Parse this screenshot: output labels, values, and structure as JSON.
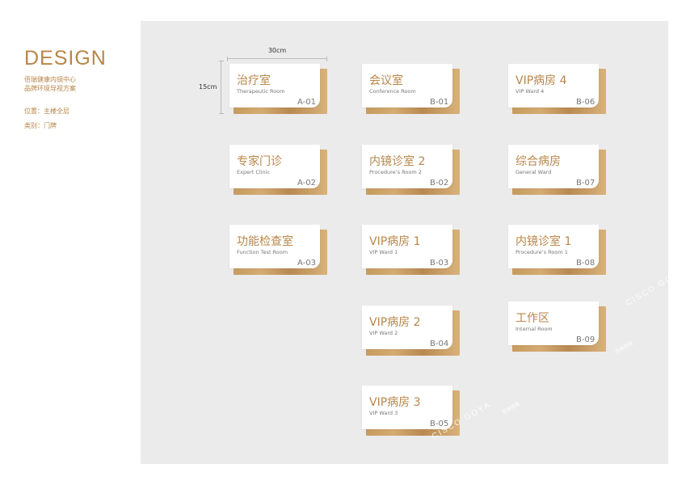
{
  "header": {
    "title": "DESIGN",
    "subtitle_line1": "佰瑞健康内镜中心",
    "subtitle_line2": "品牌环境导视方案",
    "location": "位置：主楼全层",
    "category": "类别：门牌"
  },
  "dimensions": {
    "width_label": "30cm",
    "height_label": "15cm"
  },
  "signs": [
    {
      "cn": "治疗室",
      "en": "Therapeutic  Room",
      "code": "A-01"
    },
    {
      "cn": "专家门诊",
      "en": "Expert Clinic",
      "code": "A-02"
    },
    {
      "cn": "功能检查室",
      "en": "Function  Test  Room",
      "code": "A-03"
    },
    {
      "cn": "会议室",
      "en": "Conference Room",
      "code": "B-01"
    },
    {
      "cn": "内镜诊室 2",
      "en": "Procedure’s  Room 2",
      "code": "B-02"
    },
    {
      "cn": "VIP病房 1",
      "en": "VIP   Ward    1",
      "code": "B-03"
    },
    {
      "cn": "VIP病房 2",
      "en": "VIP   Ward    2",
      "code": "B-04"
    },
    {
      "cn": "VIP病房 3",
      "en": "VIP   Ward    3",
      "code": "B-05"
    },
    {
      "cn": "VIP病房 4",
      "en": "VIP   Ward    4",
      "code": "B-06"
    },
    {
      "cn": "综合病房",
      "en": "General  Ward",
      "code": "B-07"
    },
    {
      "cn": "内镜诊室 1",
      "en": "Procedure’s  Room 1",
      "code": "B-08"
    },
    {
      "cn": "工作区",
      "en": "Internal  Room",
      "code": "B-09"
    }
  ],
  "watermark": {
    "brand": "CISCO GOYA",
    "small": "思高視覺"
  },
  "colors": {
    "accent": "#b8864a",
    "panel": "#ebebeb",
    "wood": "#c79b5f"
  }
}
